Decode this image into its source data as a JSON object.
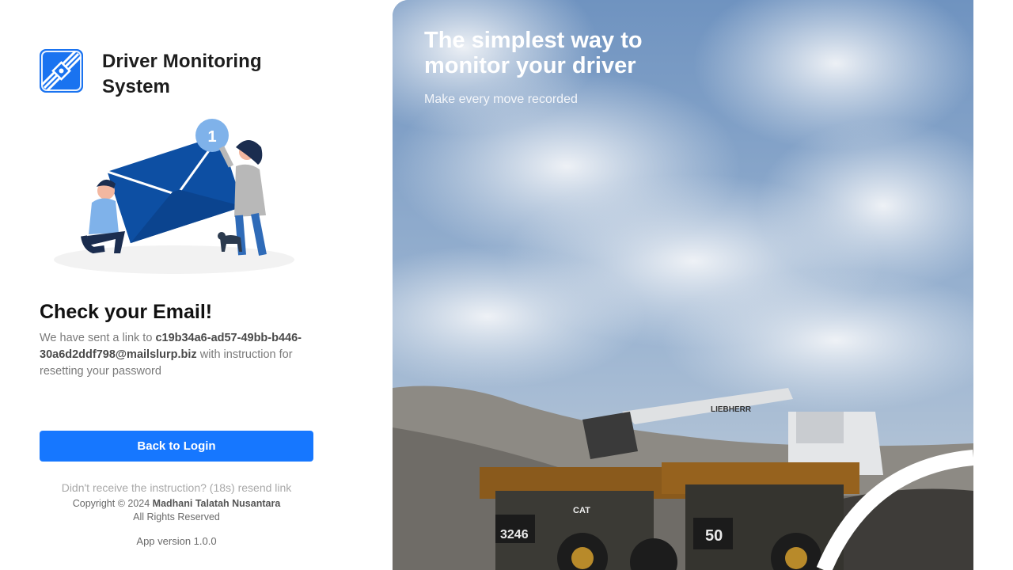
{
  "brand": {
    "name": "Driver Monitoring System",
    "logo_icon": "chain-link-icon",
    "color": "#1a73f0"
  },
  "illustration": {
    "icon": "email-sent-illustration",
    "badge_count": "1"
  },
  "content": {
    "title": "Check your Email!",
    "desc_prefix": "We have sent a link to ",
    "email": "c19b34a6-ad57-49bb-b446-30a6d2ddf798@mailslurp.biz",
    "desc_suffix": " with instruction for resetting your password"
  },
  "actions": {
    "back_to_login": "Back to Login",
    "resend": "Didn't receive the instruction? (18s) resend link"
  },
  "footer": {
    "copyright_prefix": "Copyright © 2024 ",
    "company": "Madhani Talatah Nusantara",
    "rights": "All Rights Reserved",
    "version": "App version 1.0.0"
  },
  "hero": {
    "title": "The simplest way to monitor your driver",
    "subtitle": "Make every move recorded",
    "image": "mining-trucks-excavator-photo",
    "truck_numbers": [
      "3246",
      "50"
    ],
    "truck_brand": "CAT",
    "excavator_brand": "LIEBHERR"
  },
  "colors": {
    "primary": "#1677ff",
    "text_muted": "#7a7a7a"
  }
}
